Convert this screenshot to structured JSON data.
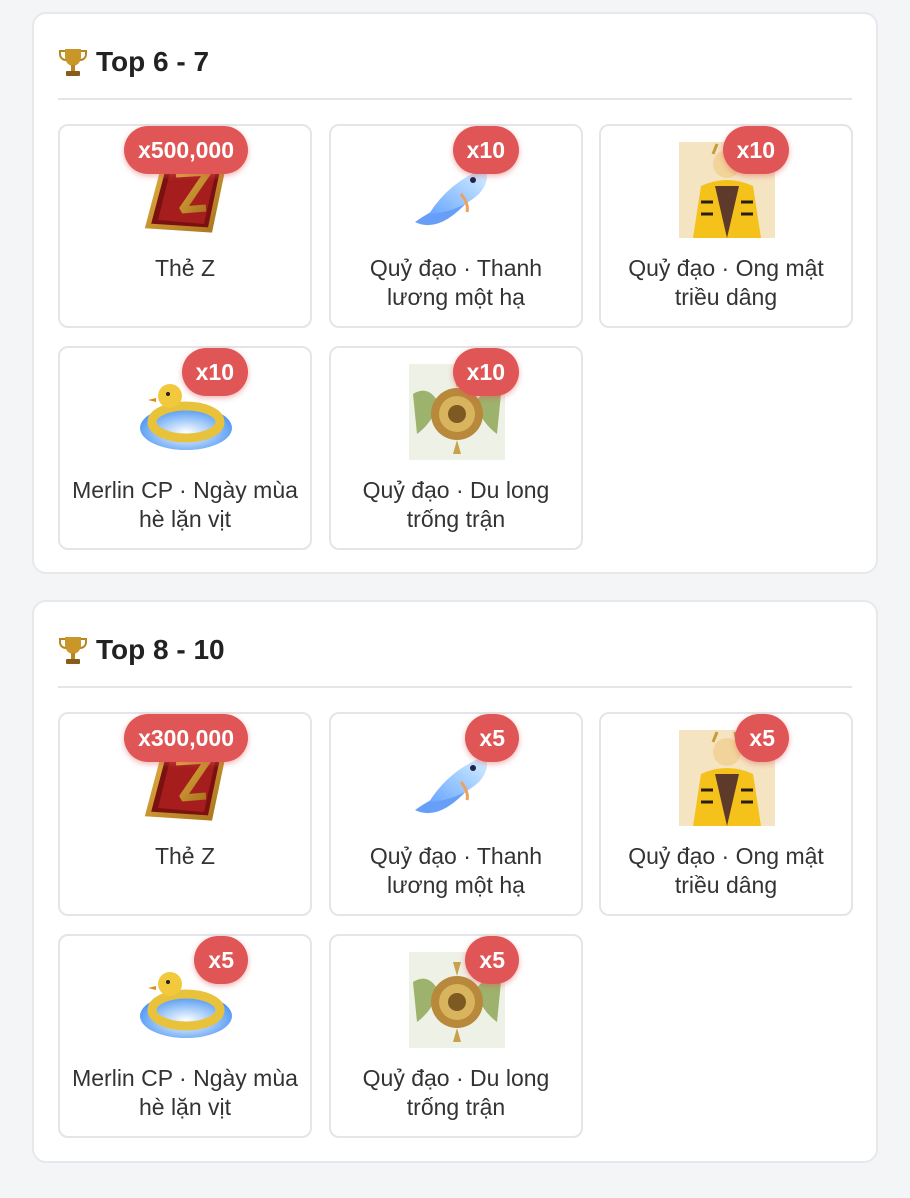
{
  "sections": [
    {
      "title": "Top 6 - 7",
      "items": [
        {
          "name": "Thẻ Z",
          "qty": "x500,000",
          "icon": "z-card-icon"
        },
        {
          "name": "Quỷ đạo · Thanh lương một hạ",
          "qty": "x10",
          "icon": "fish-trail-icon"
        },
        {
          "name": "Quỷ đạo · Ong mật triều dâng",
          "qty": "x10",
          "icon": "bee-character-icon"
        },
        {
          "name": "Merlin CP · Ngày mùa hè lặn vịt",
          "qty": "x10",
          "icon": "duck-float-icon"
        },
        {
          "name": "Quỷ đạo · Du long trống trận",
          "qty": "x10",
          "icon": "dragon-drum-icon"
        }
      ]
    },
    {
      "title": "Top 8 - 10",
      "items": [
        {
          "name": "Thẻ Z",
          "qty": "x300,000",
          "icon": "z-card-icon"
        },
        {
          "name": "Quỷ đạo · Thanh lương một hạ",
          "qty": "x5",
          "icon": "fish-trail-icon"
        },
        {
          "name": "Quỷ đạo · Ong mật triều dâng",
          "qty": "x5",
          "icon": "bee-character-icon"
        },
        {
          "name": "Merlin CP · Ngày mùa hè lặn vịt",
          "qty": "x5",
          "icon": "duck-float-icon"
        },
        {
          "name": "Quỷ đạo · Du long trống trận",
          "qty": "x5",
          "icon": "dragon-drum-icon"
        }
      ]
    }
  ],
  "colors": {
    "badge": "#e05656",
    "card_border": "#e3e5e8",
    "background": "#f4f5f7"
  }
}
